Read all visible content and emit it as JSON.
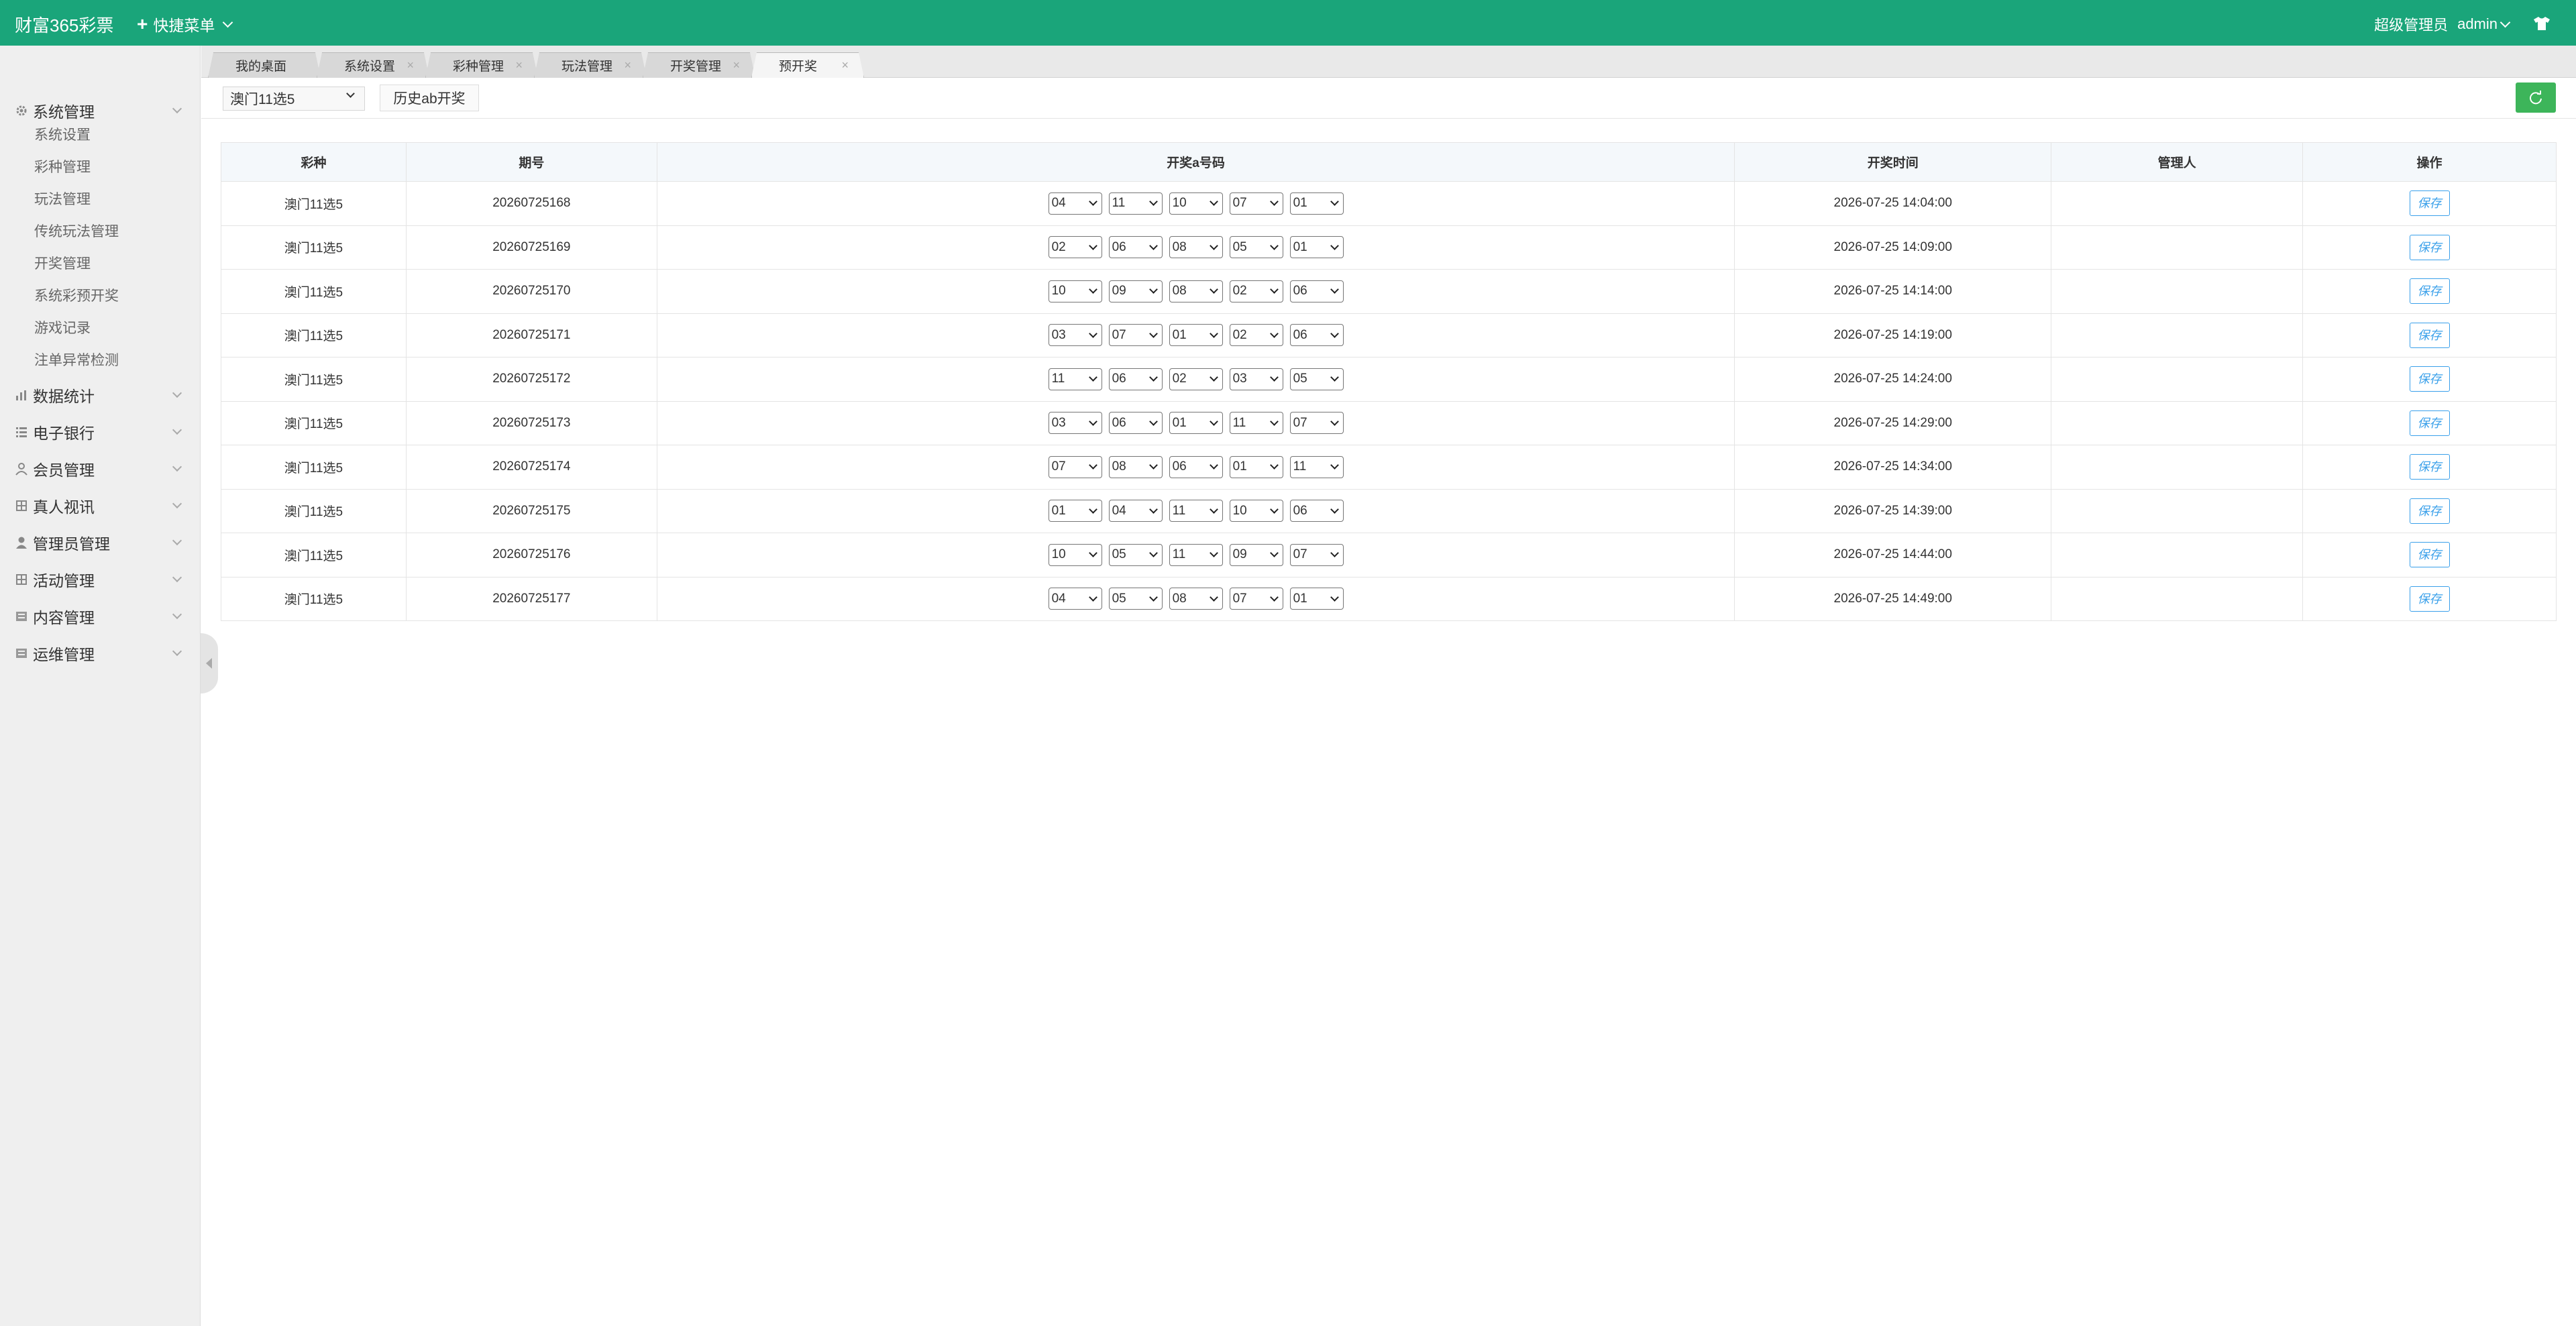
{
  "header": {
    "logo": "财富365彩票",
    "quick_menu": "快捷菜单",
    "role": "超级管理员",
    "user": "admin"
  },
  "sidebar": {
    "groups": [
      {
        "label": "系统管理",
        "icon": "gear-icon"
      },
      {
        "label": "数据统计",
        "icon": "bar-chart-icon"
      },
      {
        "label": "电子银行",
        "icon": "list-icon"
      },
      {
        "label": "会员管理",
        "icon": "user-icon"
      },
      {
        "label": "真人视讯",
        "icon": "grid-icon"
      },
      {
        "label": "管理员管理",
        "icon": "admin-user-icon"
      },
      {
        "label": "活动管理",
        "icon": "grid-icon"
      },
      {
        "label": "内容管理",
        "icon": "folder-icon"
      },
      {
        "label": "运维管理",
        "icon": "folder-icon"
      }
    ],
    "subitems": [
      "系统设置",
      "彩种管理",
      "玩法管理",
      "传统玩法管理",
      "开奖管理",
      "系统彩预开奖",
      "游戏记录",
      "注单异常检测"
    ]
  },
  "tabs": [
    {
      "label": "我的桌面"
    },
    {
      "label": "系统设置"
    },
    {
      "label": "彩种管理"
    },
    {
      "label": "玩法管理"
    },
    {
      "label": "开奖管理"
    },
    {
      "label": "预开奖"
    }
  ],
  "toolbar": {
    "lottery_select": "澳门11选5",
    "history_button": "历史ab开奖"
  },
  "table": {
    "headers": [
      "彩种",
      "期号",
      "开奖a号码",
      "开奖时间",
      "管理人",
      "操作"
    ],
    "save_label": "保存",
    "rows": [
      {
        "lottery": "澳门11选5",
        "issue": "20260725168",
        "nums": [
          "04",
          "11",
          "10",
          "07",
          "01"
        ],
        "time": "2026-07-25 14:04:00",
        "manager": ""
      },
      {
        "lottery": "澳门11选5",
        "issue": "20260725169",
        "nums": [
          "02",
          "06",
          "08",
          "05",
          "01"
        ],
        "time": "2026-07-25 14:09:00",
        "manager": ""
      },
      {
        "lottery": "澳门11选5",
        "issue": "20260725170",
        "nums": [
          "10",
          "09",
          "08",
          "02",
          "06"
        ],
        "time": "2026-07-25 14:14:00",
        "manager": ""
      },
      {
        "lottery": "澳门11选5",
        "issue": "20260725171",
        "nums": [
          "03",
          "07",
          "01",
          "02",
          "06"
        ],
        "time": "2026-07-25 14:19:00",
        "manager": ""
      },
      {
        "lottery": "澳门11选5",
        "issue": "20260725172",
        "nums": [
          "11",
          "06",
          "02",
          "03",
          "05"
        ],
        "time": "2026-07-25 14:24:00",
        "manager": ""
      },
      {
        "lottery": "澳门11选5",
        "issue": "20260725173",
        "nums": [
          "03",
          "06",
          "01",
          "11",
          "07"
        ],
        "time": "2026-07-25 14:29:00",
        "manager": ""
      },
      {
        "lottery": "澳门11选5",
        "issue": "20260725174",
        "nums": [
          "07",
          "08",
          "06",
          "01",
          "11"
        ],
        "time": "2026-07-25 14:34:00",
        "manager": ""
      },
      {
        "lottery": "澳门11选5",
        "issue": "20260725175",
        "nums": [
          "01",
          "04",
          "11",
          "10",
          "06"
        ],
        "time": "2026-07-25 14:39:00",
        "manager": ""
      },
      {
        "lottery": "澳门11选5",
        "issue": "20260725176",
        "nums": [
          "10",
          "05",
          "11",
          "09",
          "07"
        ],
        "time": "2026-07-25 14:44:00",
        "manager": ""
      },
      {
        "lottery": "澳门11选5",
        "issue": "20260725177",
        "nums": [
          "04",
          "05",
          "08",
          "07",
          "01"
        ],
        "time": "2026-07-25 14:49:00",
        "manager": ""
      }
    ]
  },
  "colors": {
    "header_bg": "#1aa57a",
    "refresh_button": "#3db55a",
    "save_button": "#3aa0ea"
  }
}
